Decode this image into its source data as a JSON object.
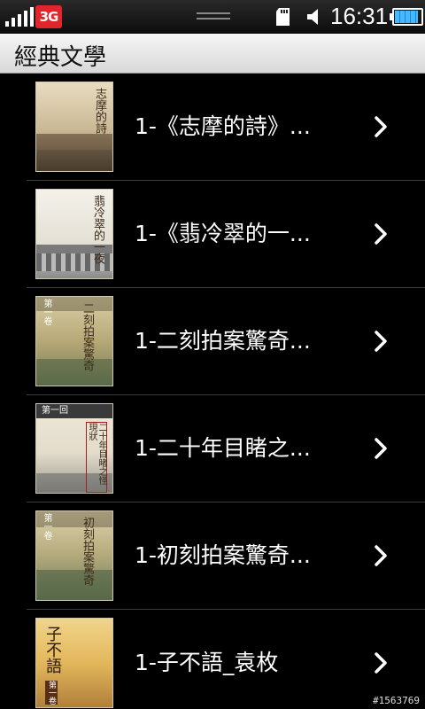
{
  "status_bar": {
    "network_badge": "3G",
    "time": "16:31",
    "battery_level": 0.9
  },
  "header": {
    "title": "經典文學"
  },
  "books": [
    {
      "label": "1-《志摩的詩》...",
      "cover_text": "志摩的詩"
    },
    {
      "label": "1-《翡冷翠的一...",
      "cover_text": "翡冷翠的一夜"
    },
    {
      "label": "1-二刻拍案驚奇...",
      "cover_text": "二刻拍案驚奇",
      "cover_tag": "第一卷"
    },
    {
      "label": "1-二十年目睹之...",
      "cover_text": "二十年目睹之怪現狀",
      "cover_tag": "第一回"
    },
    {
      "label": "1-初刻拍案驚奇...",
      "cover_text": "初刻拍案驚奇",
      "cover_tag": "第一卷"
    },
    {
      "label": "1-子不語_袁枚",
      "cover_text": "子不語",
      "cover_tag": "第一卷"
    }
  ],
  "watermark": "#1563769",
  "colors": {
    "background": "#000000",
    "title_bar": "#e6e6e6",
    "network_badge": "#e0262b",
    "battery": "#47b8ff"
  },
  "icons": {
    "signal": "signal-icon",
    "sd_card": "sd-card-icon",
    "volume": "volume-icon",
    "chevron": "chevron-right-icon"
  }
}
